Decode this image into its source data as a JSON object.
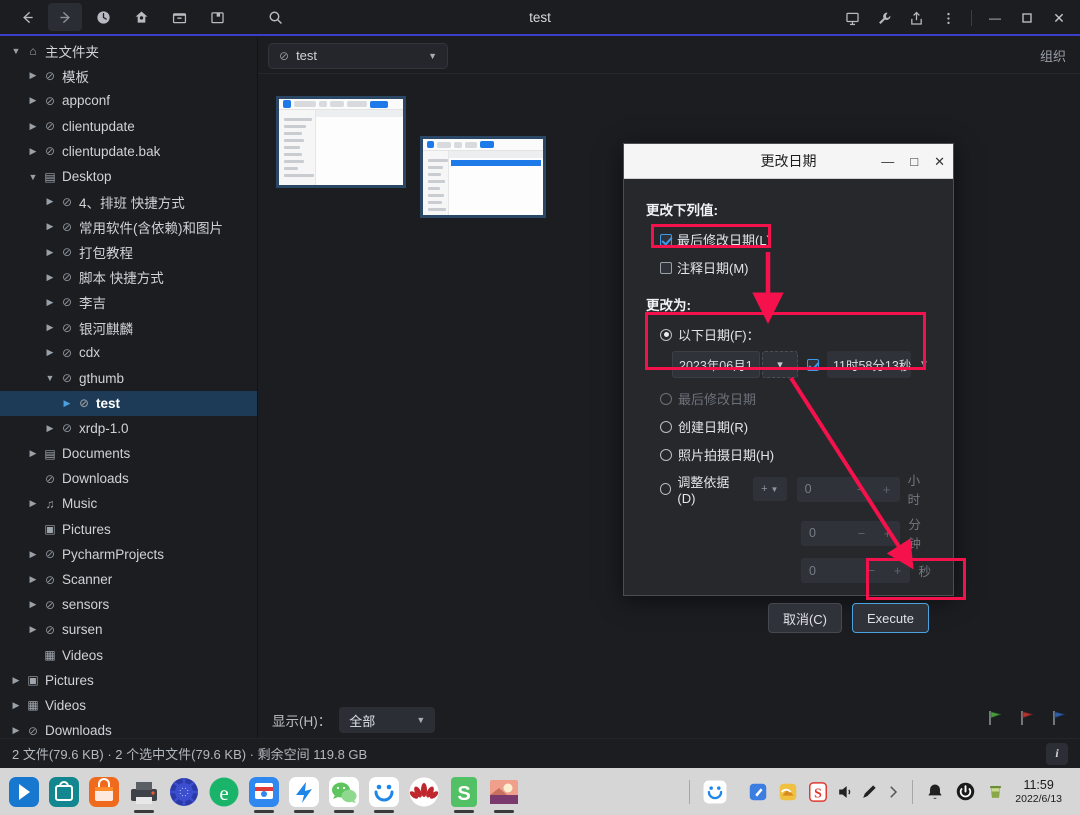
{
  "window": {
    "title": "test",
    "toolbar_left": [
      {
        "name": "back-button",
        "glyph": "←",
        "active": false
      },
      {
        "name": "forward-button",
        "glyph": "→",
        "active": true
      },
      {
        "name": "history-button",
        "glyph": "clock",
        "active": false
      },
      {
        "name": "home-button",
        "glyph": "home",
        "active": false
      },
      {
        "name": "archive-button",
        "glyph": "archive",
        "active": false
      },
      {
        "name": "catalog-button",
        "glyph": "catalog",
        "active": false
      },
      {
        "name": "search-button",
        "glyph": "search",
        "active": false
      }
    ],
    "toolbar_right": [
      {
        "name": "slideshow-button",
        "glyph": "screen"
      },
      {
        "name": "tools-button",
        "glyph": "wrench"
      },
      {
        "name": "share-button",
        "glyph": "share"
      },
      {
        "name": "menu-button",
        "glyph": "kebab"
      }
    ],
    "controls": {
      "minimize": "—",
      "maximize": "▫",
      "close": "✕"
    }
  },
  "sidebar": {
    "items": [
      {
        "label": "主文件夹",
        "indent": 0,
        "twisty": "down",
        "icon": "home",
        "selected": false
      },
      {
        "label": "模板",
        "indent": 1,
        "twisty": "right",
        "icon": "blocked",
        "selected": false
      },
      {
        "label": "appconf",
        "indent": 1,
        "twisty": "right",
        "icon": "blocked",
        "selected": false
      },
      {
        "label": "clientupdate",
        "indent": 1,
        "twisty": "right",
        "icon": "blocked",
        "selected": false
      },
      {
        "label": "clientupdate.bak",
        "indent": 1,
        "twisty": "right",
        "icon": "blocked",
        "selected": false
      },
      {
        "label": "Desktop",
        "indent": 1,
        "twisty": "down",
        "icon": "desktop",
        "selected": false
      },
      {
        "label": "4、排班 快捷方式",
        "indent": 2,
        "twisty": "right",
        "icon": "blocked",
        "selected": false
      },
      {
        "label": "常用软件(含依赖)和图片",
        "indent": 2,
        "twisty": "right",
        "icon": "blocked",
        "selected": false
      },
      {
        "label": "打包教程",
        "indent": 2,
        "twisty": "right",
        "icon": "blocked",
        "selected": false
      },
      {
        "label": "脚本 快捷方式",
        "indent": 2,
        "twisty": "right",
        "icon": "blocked",
        "selected": false
      },
      {
        "label": "李吉",
        "indent": 2,
        "twisty": "right",
        "icon": "blocked",
        "selected": false
      },
      {
        "label": "银河麒麟",
        "indent": 2,
        "twisty": "right",
        "icon": "blocked",
        "selected": false
      },
      {
        "label": "cdx",
        "indent": 2,
        "twisty": "right",
        "icon": "blocked",
        "selected": false
      },
      {
        "label": "gthumb",
        "indent": 2,
        "twisty": "down",
        "icon": "blocked",
        "selected": false
      },
      {
        "label": "test",
        "indent": 3,
        "twisty": "right",
        "icon": "blocked",
        "selected": true
      },
      {
        "label": "xrdp-1.0",
        "indent": 2,
        "twisty": "right",
        "icon": "blocked",
        "selected": false
      },
      {
        "label": "Documents",
        "indent": 1,
        "twisty": "right",
        "icon": "document",
        "selected": false
      },
      {
        "label": "Downloads",
        "indent": 1,
        "twisty": "none",
        "icon": "blocked",
        "selected": false
      },
      {
        "label": "Music",
        "indent": 1,
        "twisty": "right",
        "icon": "music",
        "selected": false
      },
      {
        "label": "Pictures",
        "indent": 1,
        "twisty": "none",
        "icon": "picture",
        "selected": false
      },
      {
        "label": "PycharmProjects",
        "indent": 1,
        "twisty": "right",
        "icon": "blocked",
        "selected": false
      },
      {
        "label": "Scanner",
        "indent": 1,
        "twisty": "right",
        "icon": "blocked",
        "selected": false
      },
      {
        "label": "sensors",
        "indent": 1,
        "twisty": "right",
        "icon": "blocked",
        "selected": false
      },
      {
        "label": "sursen",
        "indent": 1,
        "twisty": "right",
        "icon": "blocked",
        "selected": false
      },
      {
        "label": "Videos",
        "indent": 1,
        "twisty": "none",
        "icon": "video",
        "selected": false
      },
      {
        "label": "Pictures",
        "indent": 0,
        "twisty": "right",
        "icon": "picture",
        "selected": false
      },
      {
        "label": "Videos",
        "indent": 0,
        "twisty": "right",
        "icon": "video",
        "selected": false
      },
      {
        "label": "Downloads",
        "indent": 0,
        "twisty": "right",
        "icon": "blocked",
        "selected": false
      }
    ]
  },
  "main": {
    "path_chip": "test",
    "organize_label": "组织",
    "thumbnails": [
      {
        "name": "thumbnail-1",
        "selected": true
      },
      {
        "name": "thumbnail-2",
        "selected": true
      }
    ]
  },
  "bottom_toolbar": {
    "filter_label": "显示(H)：",
    "filter_value": "全部",
    "flags": [
      {
        "name": "flag-green",
        "color": "#4a9c3c"
      },
      {
        "name": "flag-red",
        "color": "#b33232"
      },
      {
        "name": "flag-blue",
        "color": "#2f5fa8"
      }
    ]
  },
  "status_bar": {
    "text": "2 文件(79.6 KB) · 2 个选中文件(79.6 KB) · 剩余空间 119.8 GB",
    "info_label": "i"
  },
  "dialog": {
    "title": "更改日期",
    "controls": {
      "minimize": "—",
      "maximize": "□",
      "close": "✕"
    },
    "section_change_values": "更改下列值:",
    "checkboxes": [
      {
        "label": "最后修改日期(L)",
        "checked": true,
        "highlighted": true
      },
      {
        "label": "注释日期(M)",
        "checked": false,
        "highlighted": false
      }
    ],
    "section_change_to": "更改为:",
    "radios": [
      {
        "label": "以下日期(F)：",
        "selected": true,
        "disabled": false,
        "highlighted": true
      },
      {
        "label": "最后修改日期",
        "selected": false,
        "disabled": true,
        "highlighted": false
      },
      {
        "label": "创建日期(R)",
        "selected": false,
        "disabled": false,
        "highlighted": false
      },
      {
        "label": "照片拍摄日期(H)",
        "selected": false,
        "disabled": false,
        "highlighted": false
      },
      {
        "label": "调整依据(D)",
        "selected": false,
        "disabled": false,
        "highlighted": false
      }
    ],
    "date_value": "2023年06月1",
    "time_checked": true,
    "time_value": "11时58分13秒",
    "adjust_sign": "+",
    "spinners": [
      {
        "value": "0",
        "unit": "小时"
      },
      {
        "value": "0",
        "unit": "分钟"
      },
      {
        "value": "0",
        "unit": "秒"
      }
    ],
    "cancel_label": "取消(C)",
    "execute_label": "Execute"
  },
  "taskbar": {
    "apps": [
      {
        "name": "taskbar-start",
        "color1": "#1878d0",
        "color2": "#2f8fe8",
        "glyph": "▶",
        "running": false
      },
      {
        "name": "taskbar-store",
        "color1": "#13878f",
        "color2": "#17a7b0",
        "glyph": "bag",
        "running": false
      },
      {
        "name": "taskbar-shop",
        "color1": "#f06a1e",
        "color2": "#ff8c2a",
        "glyph": "shop",
        "running": false
      },
      {
        "name": "taskbar-printer",
        "color1": "#3d4148",
        "color2": "#5a5f66",
        "glyph": "printer",
        "running": true
      },
      {
        "name": "taskbar-settings",
        "color1": "#2a3aa8",
        "color2": "#3b4fd0",
        "glyph": "gear",
        "running": false
      },
      {
        "name": "taskbar-edge",
        "color1": "#0a8f4c",
        "color2": "#19b46a",
        "glyph": "e",
        "running": false
      },
      {
        "name": "taskbar-mail",
        "color1": "#1b6fd6",
        "color2": "#2e88ef",
        "glyph": "mail",
        "running": true
      },
      {
        "name": "taskbar-dingtalk",
        "color1": "#ffffff",
        "color2": "#ffffff",
        "glyph": "dt",
        "running": true
      },
      {
        "name": "taskbar-wechat",
        "color1": "#ffffff",
        "color2": "#ffffff",
        "glyph": "wechat",
        "running": true
      },
      {
        "name": "taskbar-uos",
        "color1": "#ffffff",
        "color2": "#ffffff",
        "glyph": "smile",
        "running": true
      },
      {
        "name": "taskbar-kingsoft",
        "color1": "#ffffff",
        "color2": "#ffffff",
        "glyph": "lotus",
        "running": false
      },
      {
        "name": "taskbar-wps",
        "color1": "#3faa52",
        "color2": "#52c065",
        "glyph": "S",
        "running": true
      },
      {
        "name": "taskbar-gthumb",
        "color1": "#e87a6a",
        "color2": "#f0a08a",
        "glyph": "photo",
        "running": true
      }
    ],
    "tray_left": [
      {
        "name": "tray-uos-assistant",
        "glyph": "smile"
      }
    ],
    "tray": [
      {
        "name": "tray-notepad-icon",
        "glyph": "pen"
      },
      {
        "name": "tray-screenshot-icon",
        "glyph": "shot"
      },
      {
        "name": "tray-sogou-input-icon",
        "glyph": "S"
      },
      {
        "name": "tray-volume-icon",
        "glyph": "speaker"
      },
      {
        "name": "tray-brightness-icon",
        "glyph": "pen2"
      },
      {
        "name": "tray-expand-icon",
        "glyph": "chevron"
      },
      {
        "name": "tray-notification-icon",
        "glyph": "bell"
      },
      {
        "name": "tray-power-icon",
        "glyph": "power"
      },
      {
        "name": "tray-trash-icon",
        "glyph": "trash"
      }
    ],
    "clock_time": "11:59",
    "clock_date": "2022/6/13"
  },
  "colors": {
    "accent_blue": "#3b3ec9",
    "selection": "#1d3a56",
    "annotation_red": "#f4114c",
    "dialog_bg": "#26282c",
    "app_bg": "#1b1d21"
  }
}
